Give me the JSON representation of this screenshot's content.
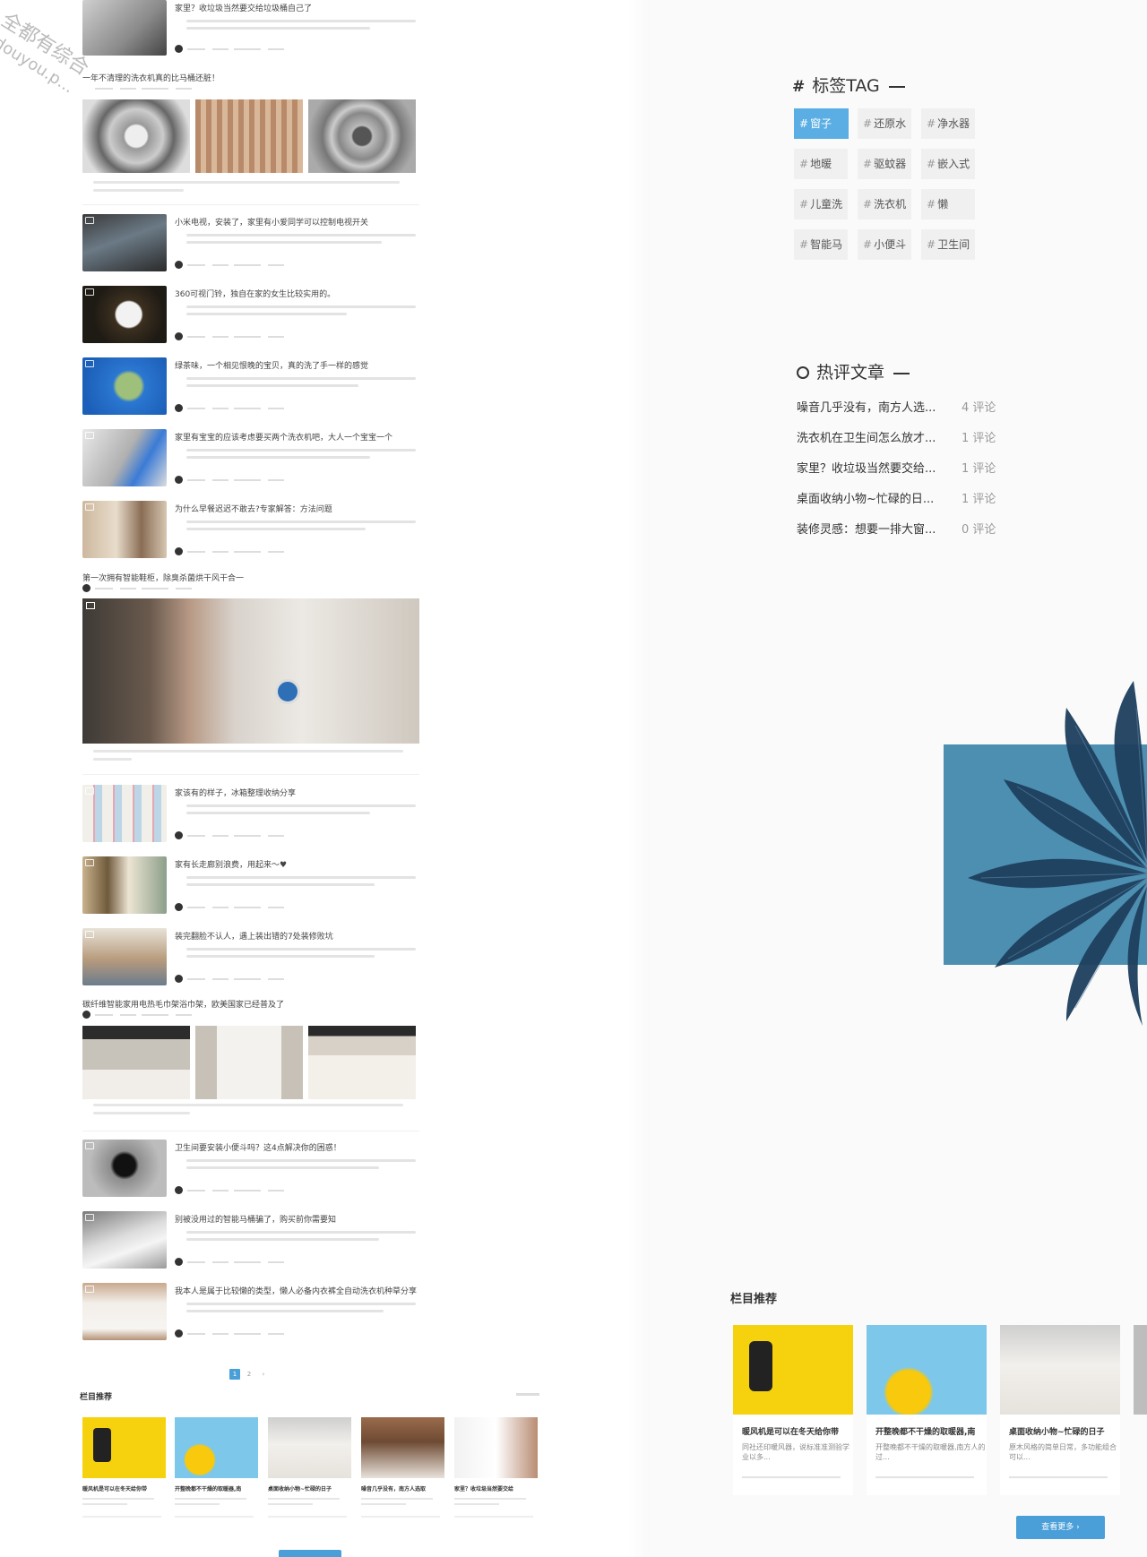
{
  "watermark": {
    "line1": "全都有综合",
    "line2": "douyou.p..."
  },
  "articles": [
    {
      "title": "家里？收垃圾当然要交给垃圾桶自己了"
    },
    {
      "title": "一年不清理的洗衣机真的比马桶还脏！"
    },
    {
      "title": "小米电视，安装了，家里有小爱同学可以控制电视开关"
    },
    {
      "title": "360可视门铃，独自在家的女生比较实用的。"
    },
    {
      "title": "绿茶味，一个相见恨晚的宝贝，真的洗了手一样的感觉"
    },
    {
      "title": "家里有宝宝的应该考虑要买两个洗衣机吧，大人一个宝宝一个"
    },
    {
      "title": "为什么早餐迟迟不敢去?专家解答：方法问题"
    },
    {
      "title": "第一次拥有智能鞋柜，除臭杀菌烘干风干合一"
    },
    {
      "title": "家该有的样子，冰箱整理收纳分享"
    },
    {
      "title": "家有长走廊别浪费，用起来～♥"
    },
    {
      "title": "装完翻脸不认人，遇上装出错的7处装修败坑"
    },
    {
      "title": "碳纤维智能家用电热毛巾架浴巾架，欧美国家已经普及了"
    },
    {
      "title": "卫生间要安装小便斗吗？这4点解决你的困惑！"
    },
    {
      "title": "别被没用过的智能马桶骗了，购买前你需要知"
    },
    {
      "title": "我本人是属于比较懒的类型，懒人必备内衣裤全自动洗衣机种草分享"
    }
  ],
  "pagination": {
    "p1": "1",
    "p2": "2",
    "next": "›"
  },
  "left_section": {
    "title": "栏目推荐",
    "cards": [
      {
        "title": "暖风机是可以在冬天给你带"
      },
      {
        "title": "开整晚都不干燥的取暖器,南"
      },
      {
        "title": "桌面收纳小物~忙碌的日子"
      },
      {
        "title": "噪音几乎没有，南方人选取"
      },
      {
        "title": "家里？收垃圾当然要交给"
      }
    ]
  },
  "tags_widget": {
    "title": "标签TAG",
    "tags": [
      "窗子",
      "还原水",
      "净水器",
      "地暖",
      "驱蚊器",
      "嵌入式",
      "儿童洗",
      "洗衣机",
      "懒",
      "智能马",
      "小便斗",
      "卫生间"
    ]
  },
  "hot_widget": {
    "title": "热评文章",
    "items": [
      {
        "title": "噪音几乎没有，南方人选...",
        "count": "4 评论"
      },
      {
        "title": "洗衣机在卫生间怎么放才...",
        "count": "1 评论"
      },
      {
        "title": "家里？收垃圾当然要交给...",
        "count": "1 评论"
      },
      {
        "title": "桌面收纳小物~忙碌的日...",
        "count": "1 评论"
      },
      {
        "title": "装修灵感：想要一排大窗...",
        "count": "0 评论"
      }
    ]
  },
  "right_section": {
    "title": "栏目推荐",
    "cards": [
      {
        "title": "暖风机是可以在冬天给你带",
        "desc": "同社还印暖风器，说标准准测验学业以多..."
      },
      {
        "title": "开整晚都不干燥的取暖器,南",
        "desc": "开整晚都不干燥的取暖器,南方人的过..."
      },
      {
        "title": "桌面收纳小物~忙碌的日子",
        "desc": "原木风格的简单日常，多功能组合可以..."
      }
    ],
    "more_button": "查看更多 ›"
  },
  "colors": {
    "accent": "#4a9fd9",
    "tag_active": "#5aaee3",
    "teal_block": "#4d8fb0",
    "leaf": "#1e3f5e"
  }
}
